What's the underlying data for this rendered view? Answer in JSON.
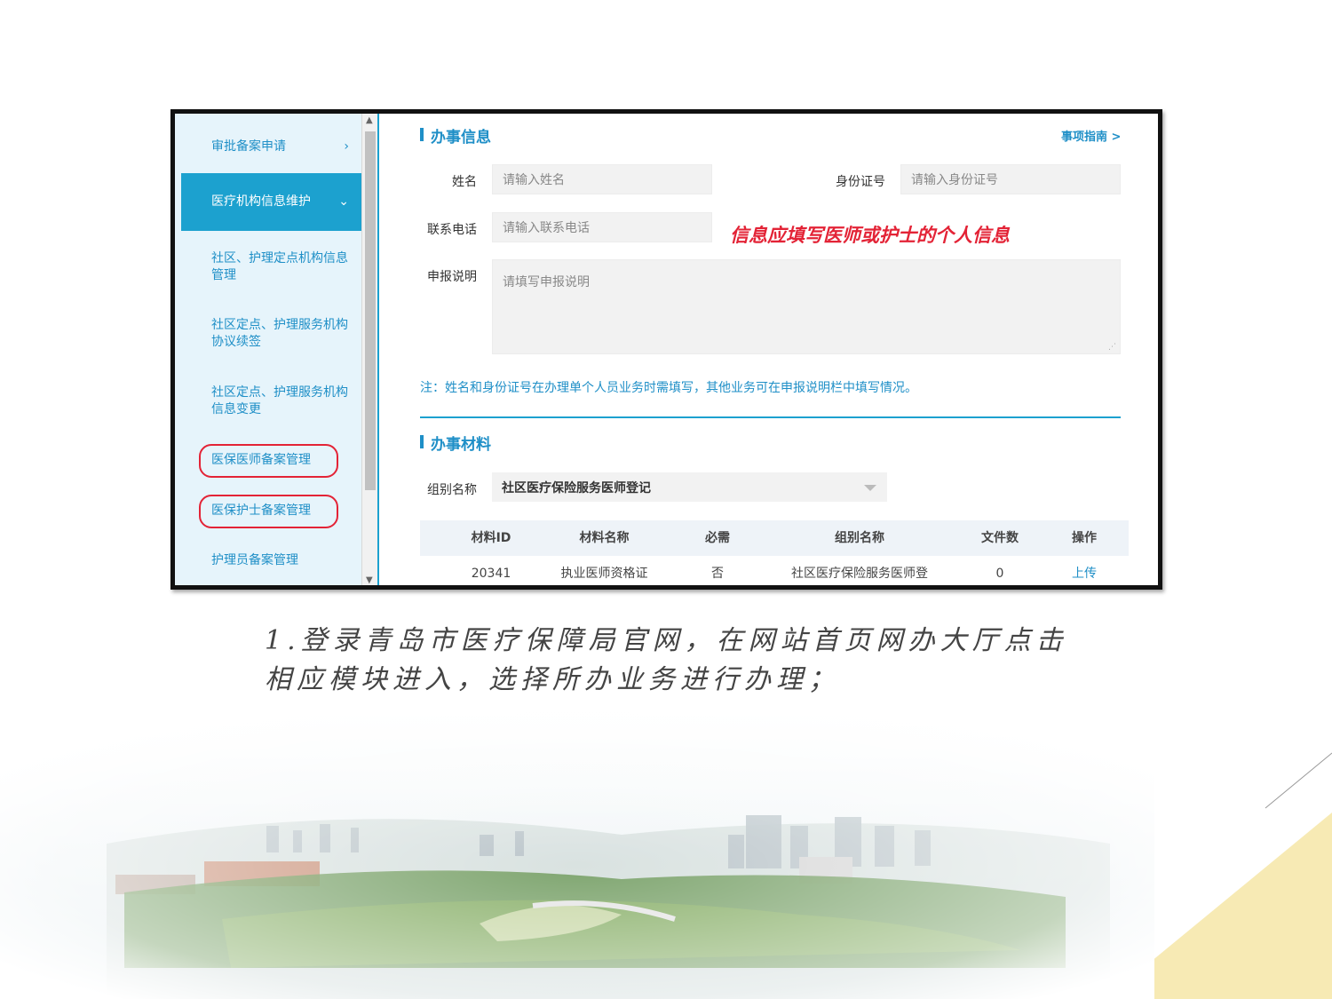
{
  "sidebar": {
    "items": [
      {
        "label": "审批备案申请",
        "arrow": "›"
      },
      {
        "label": "医疗机构信息维护",
        "arrow": "⌄"
      },
      {
        "label": "社区、护理定点机构信息管理"
      },
      {
        "label": "社区定点、护理服务机构协议续签"
      },
      {
        "label": "社区定点、护理服务机构信息变更"
      },
      {
        "label": "医保医师备案管理"
      },
      {
        "label": "医保护士备案管理"
      },
      {
        "label": "护理员备案管理"
      }
    ]
  },
  "info_section": {
    "title": "办事信息",
    "guide_link": "事项指南 >",
    "name_label": "姓名",
    "name_placeholder": "请输入姓名",
    "id_label": "身份证号",
    "id_placeholder": "请输入身份证号",
    "phone_label": "联系电话",
    "phone_placeholder": "请输入联系电话",
    "annotation": "信息应填写医师或护士的个人信息",
    "desc_label": "申报说明",
    "desc_placeholder": "请填写申报说明",
    "note": "注：姓名和身份证号在办理单个人员业务时需填写，其他业务可在申报说明栏中填写情况。"
  },
  "materials_section": {
    "title": "办事材料",
    "group_label": "组别名称",
    "group_value": "社区医疗保险服务医师登记",
    "columns": [
      "材料ID",
      "材料名称",
      "必需",
      "组别名称",
      "文件数",
      "操作"
    ],
    "rows": [
      [
        "20341",
        "执业医师资格证",
        "否",
        "社区医疗保险服务医师登",
        "0",
        "上传"
      ]
    ]
  },
  "caption": {
    "line1": "1.登录青岛市医疗保障局官网，在网站首页网办大厅点击",
    "line2": "相应模块进入，选择所办业务进行办理；"
  },
  "colors": {
    "accent": "#1ca1cf",
    "link": "#1f8fc7",
    "highlight_red": "#e32336",
    "corner_yellow": "#f6e7a8"
  }
}
